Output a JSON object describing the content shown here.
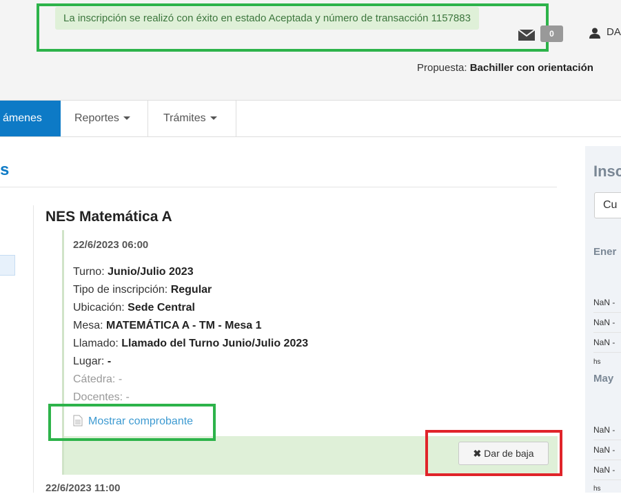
{
  "header": {
    "alert_message": "La inscripción se realizó con éxito en estado Aceptada y número de transacción 1157883",
    "mail_count": "0",
    "user_name": "DA",
    "propuesta_label": "Propuesta:",
    "propuesta_value": "Bachiller con orientación"
  },
  "nav": {
    "active_label": "ámenes",
    "items": [
      {
        "label": "Reportes"
      },
      {
        "label": "Trámites"
      }
    ]
  },
  "section": {
    "title_fragment": "s"
  },
  "subject": {
    "title": "NES Matemática A",
    "exam": {
      "datetime": "22/6/2023 06:00",
      "fields": [
        {
          "label": "Turno:",
          "value": "Junio/Julio 2023"
        },
        {
          "label": "Tipo de inscripción:",
          "value": "Regular"
        },
        {
          "label": "Ubicación:",
          "value": "Sede Central"
        },
        {
          "label": "Mesa:",
          "value": "MATEMÁTICA A - TM - Mesa 1"
        },
        {
          "label": "Llamado:",
          "value": "Llamado del Turno Junio/Julio 2023"
        },
        {
          "label": "Lugar:",
          "value": "-"
        }
      ],
      "catedra": "Cátedra: -",
      "docentes": "Docentes: -",
      "show_receipt_label": "Mostrar comprobante",
      "unsubscribe_label": "Dar de baja"
    },
    "next_exam_datetime": "22/6/2023 11:00"
  },
  "right_panel": {
    "title": "Insc",
    "select_value": "Cu",
    "months": [
      {
        "label": "Ener",
        "rows": [
          "NaN -",
          "NaN -",
          "NaN -"
        ],
        "footer": "hs"
      },
      {
        "label": "May",
        "rows": [
          "NaN -",
          "NaN -",
          "NaN -"
        ],
        "footer": "hs"
      }
    ]
  },
  "colors": {
    "accent": "#0d7ac6",
    "success_bg": "#dff0d8",
    "success_text": "#3c763d",
    "highlight_green": "#2db34a",
    "highlight_red": "#e0242a"
  },
  "icons": {
    "mail": "envelope-icon",
    "user": "user-icon",
    "document": "document-icon",
    "remove": "times-icon"
  }
}
